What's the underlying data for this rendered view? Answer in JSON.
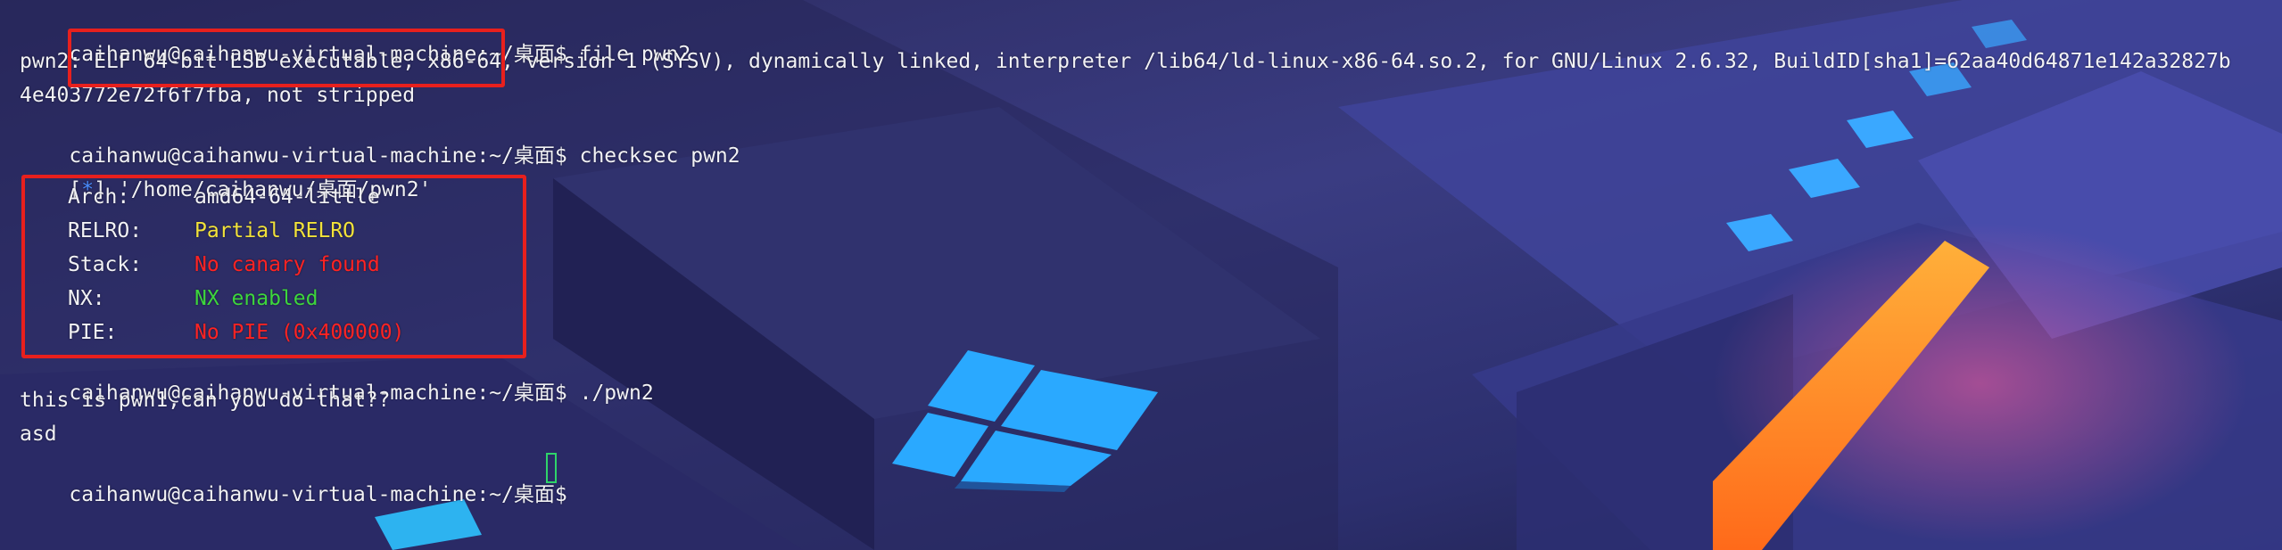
{
  "terminal": {
    "lines": {
      "l1_prompt": "caihanwu@caihanwu-virtual-machine:~/桌面$",
      "l1_cmd": " file pwn2",
      "l2": "pwn2: ELF 64-bit LSB executable, x86-64, version 1 (SYSV), dynamically linked, interpreter /lib64/ld-linux-x86-64.so.2, for GNU/Linux 2.6.32, BuildID[sha1]=62aa40d64871e142a32827b",
      "l3": "4e403772e72f6f7fba, not stripped",
      "l4_prompt": "caihanwu@caihanwu-virtual-machine:~/桌面$",
      "l4_cmd": " checksec pwn2",
      "l5_bracket_open": "[",
      "l5_star": "*",
      "l5_rest": "] '/home/caihanwu/桌面/pwn2'",
      "arch_label": "Arch:",
      "arch_value": "amd64-64-little",
      "relro_label": "RELRO:",
      "relro_value": "Partial RELRO",
      "stack_label": "Stack:",
      "stack_value": "No canary found",
      "nx_label": "NX:",
      "nx_value": "NX enabled",
      "pie_label": "PIE:",
      "pie_value": "No PIE (0x400000)",
      "l11_prompt": "caihanwu@caihanwu-virtual-machine:~/桌面$",
      "l11_cmd": " ./pwn2",
      "l12": "this is pwn1,can you do that??",
      "l13": "asd",
      "l14_prompt": "caihanwu@caihanwu-virtual-machine:~/桌面$"
    }
  },
  "colors": {
    "text": "#f2f2f5",
    "yellow": "#f2e23a",
    "red": "#ff2323",
    "green": "#3dd63d",
    "blue": "#4a8dff",
    "annotation_box": "#e8201d",
    "cursor": "#2fd36a"
  },
  "icons": {
    "cursor": "block-cursor-icon",
    "wallpaper_logo": "windows-logo-icon"
  }
}
